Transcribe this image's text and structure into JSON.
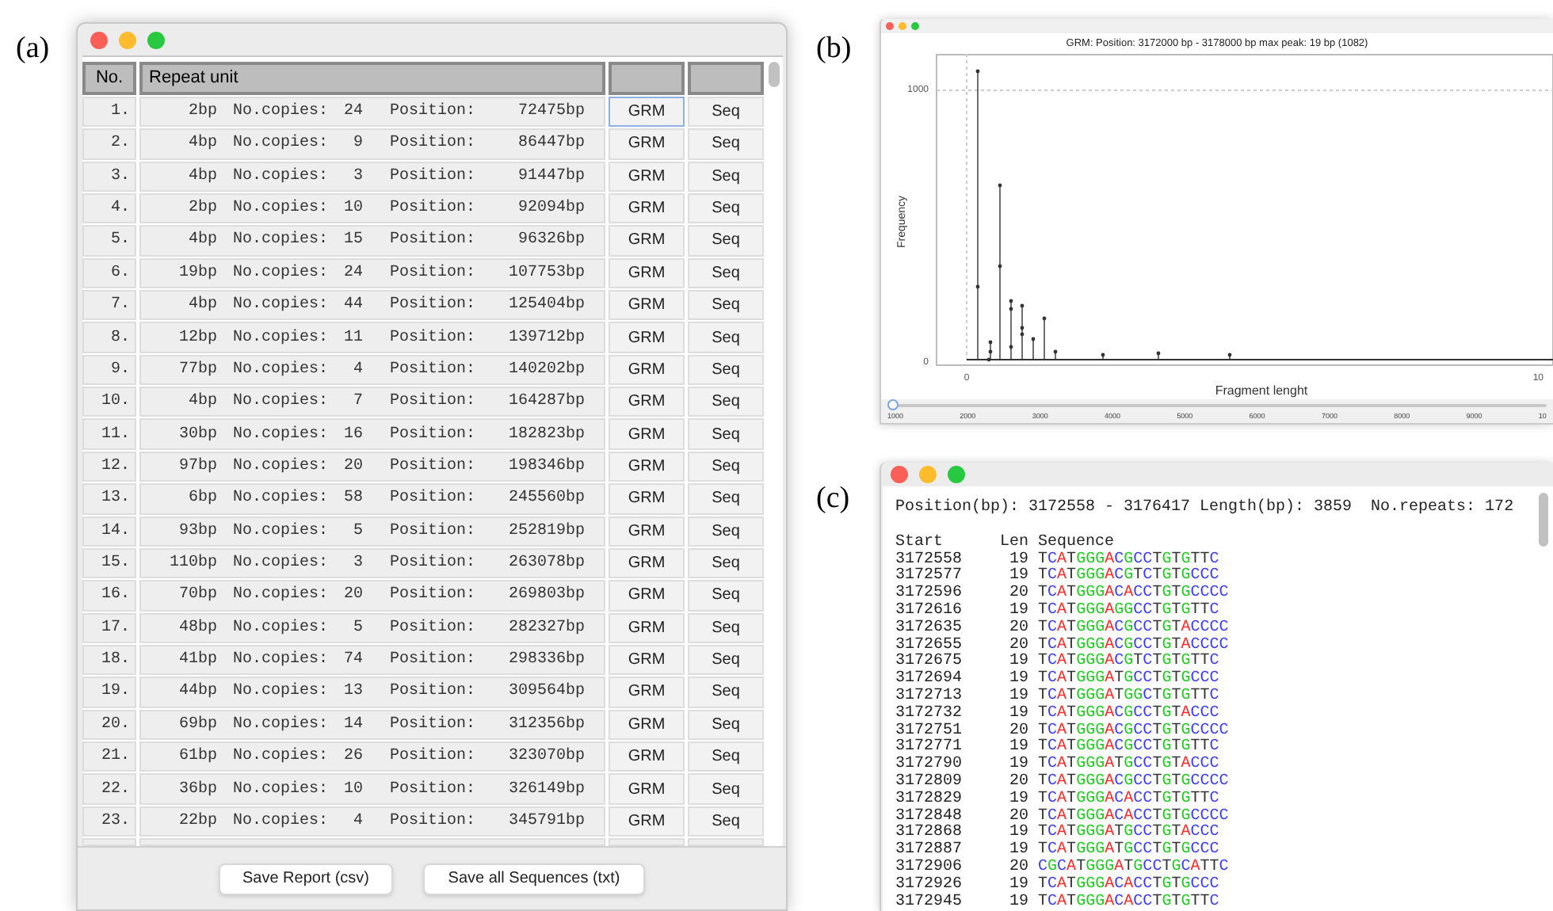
{
  "panel_labels": [
    "(a)",
    "(b)",
    "(c)"
  ],
  "repeats_window": {
    "columns": [
      "No.",
      "Repeat unit",
      "",
      ""
    ],
    "rows": [
      {
        "no": "1.",
        "unit": "2bp",
        "copies_label": "No.copies:",
        "copies": "24",
        "position_label": "Position:",
        "position": "72475bp",
        "grm": "GRM",
        "seq": "Seq",
        "grm_focused": true
      },
      {
        "no": "2.",
        "unit": "4bp",
        "copies_label": "No.copies:",
        "copies": "9",
        "position_label": "Position:",
        "position": "86447bp",
        "grm": "GRM",
        "seq": "Seq",
        "grm_focused": false
      },
      {
        "no": "3.",
        "unit": "4bp",
        "copies_label": "No.copies:",
        "copies": "3",
        "position_label": "Position:",
        "position": "91447bp",
        "grm": "GRM",
        "seq": "Seq",
        "grm_focused": false
      },
      {
        "no": "4.",
        "unit": "2bp",
        "copies_label": "No.copies:",
        "copies": "10",
        "position_label": "Position:",
        "position": "92094bp",
        "grm": "GRM",
        "seq": "Seq",
        "grm_focused": false
      },
      {
        "no": "5.",
        "unit": "4bp",
        "copies_label": "No.copies:",
        "copies": "15",
        "position_label": "Position:",
        "position": "96326bp",
        "grm": "GRM",
        "seq": "Seq",
        "grm_focused": false
      },
      {
        "no": "6.",
        "unit": "19bp",
        "copies_label": "No.copies:",
        "copies": "24",
        "position_label": "Position:",
        "position": "107753bp",
        "grm": "GRM",
        "seq": "Seq",
        "grm_focused": false
      },
      {
        "no": "7.",
        "unit": "4bp",
        "copies_label": "No.copies:",
        "copies": "44",
        "position_label": "Position:",
        "position": "125404bp",
        "grm": "GRM",
        "seq": "Seq",
        "grm_focused": false
      },
      {
        "no": "8.",
        "unit": "12bp",
        "copies_label": "No.copies:",
        "copies": "11",
        "position_label": "Position:",
        "position": "139712bp",
        "grm": "GRM",
        "seq": "Seq",
        "grm_focused": false
      },
      {
        "no": "9.",
        "unit": "77bp",
        "copies_label": "No.copies:",
        "copies": "4",
        "position_label": "Position:",
        "position": "140202bp",
        "grm": "GRM",
        "seq": "Seq",
        "grm_focused": false
      },
      {
        "no": "10.",
        "unit": "4bp",
        "copies_label": "No.copies:",
        "copies": "7",
        "position_label": "Position:",
        "position": "164287bp",
        "grm": "GRM",
        "seq": "Seq",
        "grm_focused": false
      },
      {
        "no": "11.",
        "unit": "30bp",
        "copies_label": "No.copies:",
        "copies": "16",
        "position_label": "Position:",
        "position": "182823bp",
        "grm": "GRM",
        "seq": "Seq",
        "grm_focused": false
      },
      {
        "no": "12.",
        "unit": "97bp",
        "copies_label": "No.copies:",
        "copies": "20",
        "position_label": "Position:",
        "position": "198346bp",
        "grm": "GRM",
        "seq": "Seq",
        "grm_focused": false
      },
      {
        "no": "13.",
        "unit": "6bp",
        "copies_label": "No.copies:",
        "copies": "58",
        "position_label": "Position:",
        "position": "245560bp",
        "grm": "GRM",
        "seq": "Seq",
        "grm_focused": false
      },
      {
        "no": "14.",
        "unit": "93bp",
        "copies_label": "No.copies:",
        "copies": "5",
        "position_label": "Position:",
        "position": "252819bp",
        "grm": "GRM",
        "seq": "Seq",
        "grm_focused": false
      },
      {
        "no": "15.",
        "unit": "110bp",
        "copies_label": "No.copies:",
        "copies": "3",
        "position_label": "Position:",
        "position": "263078bp",
        "grm": "GRM",
        "seq": "Seq",
        "grm_focused": false
      },
      {
        "no": "16.",
        "unit": "70bp",
        "copies_label": "No.copies:",
        "copies": "20",
        "position_label": "Position:",
        "position": "269803bp",
        "grm": "GRM",
        "seq": "Seq",
        "grm_focused": false
      },
      {
        "no": "17.",
        "unit": "48bp",
        "copies_label": "No.copies:",
        "copies": "5",
        "position_label": "Position:",
        "position": "282327bp",
        "grm": "GRM",
        "seq": "Seq",
        "grm_focused": false
      },
      {
        "no": "18.",
        "unit": "41bp",
        "copies_label": "No.copies:",
        "copies": "74",
        "position_label": "Position:",
        "position": "298336bp",
        "grm": "GRM",
        "seq": "Seq",
        "grm_focused": false
      },
      {
        "no": "19.",
        "unit": "44bp",
        "copies_label": "No.copies:",
        "copies": "13",
        "position_label": "Position:",
        "position": "309564bp",
        "grm": "GRM",
        "seq": "Seq",
        "grm_focused": false
      },
      {
        "no": "20.",
        "unit": "69bp",
        "copies_label": "No.copies:",
        "copies": "14",
        "position_label": "Position:",
        "position": "312356bp",
        "grm": "GRM",
        "seq": "Seq",
        "grm_focused": false
      },
      {
        "no": "21.",
        "unit": "61bp",
        "copies_label": "No.copies:",
        "copies": "26",
        "position_label": "Position:",
        "position": "323070bp",
        "grm": "GRM",
        "seq": "Seq",
        "grm_focused": false
      },
      {
        "no": "22.",
        "unit": "36bp",
        "copies_label": "No.copies:",
        "copies": "10",
        "position_label": "Position:",
        "position": "326149bp",
        "grm": "GRM",
        "seq": "Seq",
        "grm_focused": false
      },
      {
        "no": "23.",
        "unit": "22bp",
        "copies_label": "No.copies:",
        "copies": "4",
        "position_label": "Position:",
        "position": "345791bp",
        "grm": "GRM",
        "seq": "Seq",
        "grm_focused": false
      }
    ],
    "buttons": [
      "Save Report (csv)",
      "Save all Sequences (txt)"
    ]
  },
  "grm_window": {
    "title": "GRM: Position: 3172000 bp - 3178000 bp  max peak: 19 bp (1082)",
    "plot": {
      "xlabel": "Fragment lenght",
      "ylabel": "Frequency",
      "y_tick_labels": [
        "1000",
        "0"
      ],
      "x_tick_labels": [
        "0",
        "10"
      ]
    },
    "slider": {
      "level": 0,
      "ticks": [
        "1000",
        "2000",
        "3000",
        "4000",
        "5000",
        "6000",
        "7000",
        "8000",
        "9000",
        "10"
      ]
    }
  },
  "sequence_window": {
    "summary": "Position(bp): 3172558 - 3176417 Length(bp): 3859  No.repeats: 172",
    "columns": [
      "Start",
      "Len",
      "Sequence"
    ],
    "rows": [
      {
        "start": "3172558",
        "len": "19",
        "sequence": "TCATGGGACGCCTGTGTTC"
      },
      {
        "start": "3172577",
        "len": "19",
        "sequence": "TCATGGGACGTCTGTGCCC"
      },
      {
        "start": "3172596",
        "len": "20",
        "sequence": "TCATGGGACACCTGTGCCCC"
      },
      {
        "start": "3172616",
        "len": "19",
        "sequence": "TCATGGGAGGCCTGTGTTC"
      },
      {
        "start": "3172635",
        "len": "20",
        "sequence": "TCATGGGACGCCTGTACCCC"
      },
      {
        "start": "3172655",
        "len": "20",
        "sequence": "TCATGGGACGCCTGTACCCC"
      },
      {
        "start": "3172675",
        "len": "19",
        "sequence": "TCATGGGACGTCTGTGTTC"
      },
      {
        "start": "3172694",
        "len": "19",
        "sequence": "TCATGGGATGCCTGTGCCC"
      },
      {
        "start": "3172713",
        "len": "19",
        "sequence": "TCATGGGATGGCTGTGTTC"
      },
      {
        "start": "3172732",
        "len": "19",
        "sequence": "TCATGGGACGCCTGTACCC"
      },
      {
        "start": "3172751",
        "len": "20",
        "sequence": "TCATGGGACGCCTGTGCCCC"
      },
      {
        "start": "3172771",
        "len": "19",
        "sequence": "TCATGGGACGCCTGTGTTC"
      },
      {
        "start": "3172790",
        "len": "19",
        "sequence": "TCATGGGATGCCTGTACCC"
      },
      {
        "start": "3172809",
        "len": "20",
        "sequence": "TCATGGGACGCCTGTGCCCC"
      },
      {
        "start": "3172829",
        "len": "19",
        "sequence": "TCATGGGACACCTGTGTTC"
      },
      {
        "start": "3172848",
        "len": "20",
        "sequence": "TCATGGGACACCTGTGCCCC"
      },
      {
        "start": "3172868",
        "len": "19",
        "sequence": "TCATGGGATGCCTGTACCC"
      },
      {
        "start": "3172887",
        "len": "19",
        "sequence": "TCATGGGATGCCTGTGCCC"
      },
      {
        "start": "3172906",
        "len": "20",
        "sequence": "CGCATGGGATGCCTGCATTC"
      },
      {
        "start": "3172926",
        "len": "19",
        "sequence": "TCATGGGACACCTGTGCCC"
      },
      {
        "start": "3172945",
        "len": "19",
        "sequence": "TCATGGGACACCTGTGTTC"
      }
    ]
  }
}
